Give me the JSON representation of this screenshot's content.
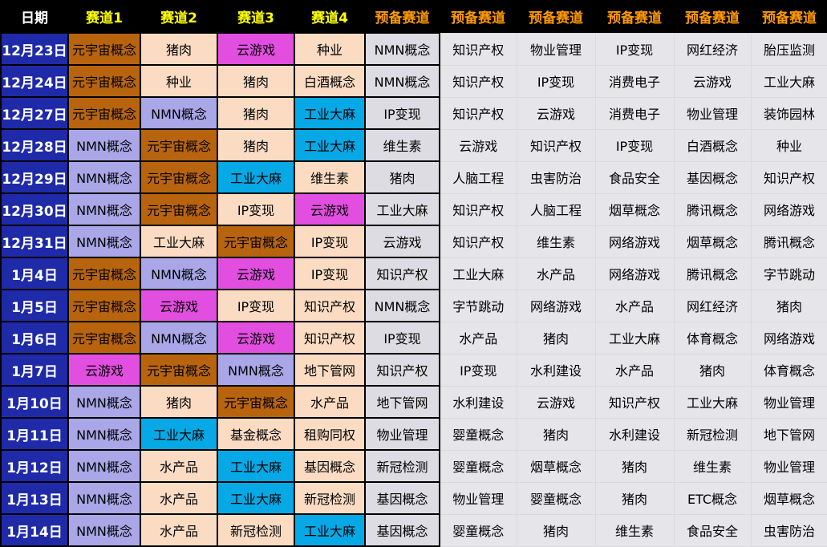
{
  "header": {
    "date": "日期",
    "tracks": [
      "赛道1",
      "赛道2",
      "赛道3",
      "赛道4"
    ],
    "spares": [
      "预备赛道",
      "预备赛道",
      "预备赛道",
      "预备赛道",
      "预备赛道",
      "预备赛道"
    ]
  },
  "colors": {
    "brown": "#b8640f",
    "lavender": "#a9a7e8",
    "peach": "#fbdcc3",
    "magenta": "#e24ee0",
    "cyan": "#06a8e6",
    "date_bg": "#1f2aa8",
    "spare_bg": "#e6e6ea"
  },
  "rows": [
    {
      "date": "12月23日",
      "t1": "元宇宙概念",
      "t1c": "c-brown",
      "t2": "猪肉",
      "t2c": "c-peach",
      "t3": "云游戏",
      "t3c": "c-magenta",
      "t4": "种业",
      "t4c": "c-peach",
      "s": [
        "NMN概念",
        "知识产权",
        "物业管理",
        "IP变现",
        "网红经济",
        "胎压监测"
      ]
    },
    {
      "date": "12月24日",
      "t1": "元宇宙概念",
      "t1c": "c-brown",
      "t2": "种业",
      "t2c": "c-peach",
      "t3": "猪肉",
      "t3c": "c-peach",
      "t4": "白酒概念",
      "t4c": "c-peach",
      "s": [
        "NMN概念",
        "知识产权",
        "IP变现",
        "消费电子",
        "云游戏",
        "工业大麻"
      ]
    },
    {
      "date": "12月27日",
      "t1": "元宇宙概念",
      "t1c": "c-brown",
      "t2": "NMN概念",
      "t2c": "c-lav",
      "t3": "猪肉",
      "t3c": "c-peach",
      "t4": "工业大麻",
      "t4c": "c-cyan",
      "s": [
        "IP变现",
        "知识产权",
        "云游戏",
        "消费电子",
        "物业管理",
        "装饰园林"
      ]
    },
    {
      "date": "12月28日",
      "t1": "NMN概念",
      "t1c": "c-lav",
      "t2": "元宇宙概念",
      "t2c": "c-brown",
      "t3": "猪肉",
      "t3c": "c-peach",
      "t4": "工业大麻",
      "t4c": "c-cyan",
      "s": [
        "维生素",
        "云游戏",
        "知识产权",
        "IP变现",
        "白酒概念",
        "种业"
      ]
    },
    {
      "date": "12月29日",
      "t1": "NMN概念",
      "t1c": "c-lav",
      "t2": "元宇宙概念",
      "t2c": "c-brown",
      "t3": "工业大麻",
      "t3c": "c-cyan",
      "t4": "维生素",
      "t4c": "c-peach",
      "s": [
        "猪肉",
        "人脑工程",
        "虫害防治",
        "食品安全",
        "基因概念",
        "知识产权"
      ]
    },
    {
      "date": "12月30日",
      "t1": "NMN概念",
      "t1c": "c-lav",
      "t2": "元宇宙概念",
      "t2c": "c-brown",
      "t3": "IP变现",
      "t3c": "c-peach",
      "t4": "云游戏",
      "t4c": "c-magenta",
      "s": [
        "工业大麻",
        "知识产权",
        "人脑工程",
        "烟草概念",
        "腾讯概念",
        "网络游戏"
      ]
    },
    {
      "date": "12月31日",
      "t1": "NMN概念",
      "t1c": "c-lav",
      "t2": "工业大麻",
      "t2c": "c-peach",
      "t3": "元宇宙概念",
      "t3c": "c-brown",
      "t4": "IP变现",
      "t4c": "c-peach",
      "s": [
        "云游戏",
        "知识产权",
        "维生素",
        "网络游戏",
        "烟草概念",
        "腾讯概念"
      ]
    },
    {
      "date": "1月4日",
      "t1": "元宇宙概念",
      "t1c": "c-brown",
      "t2": "NMN概念",
      "t2c": "c-lav",
      "t3": "云游戏",
      "t3c": "c-magenta",
      "t4": "IP变现",
      "t4c": "c-peach",
      "s": [
        "知识产权",
        "工业大麻",
        "水产品",
        "网络游戏",
        "腾讯概念",
        "字节跳动"
      ]
    },
    {
      "date": "1月5日",
      "t1": "元宇宙概念",
      "t1c": "c-brown",
      "t2": "云游戏",
      "t2c": "c-magenta",
      "t3": "IP变现",
      "t3c": "c-peach",
      "t4": "知识产权",
      "t4c": "c-peach",
      "s": [
        "NMN概念",
        "字节跳动",
        "网络游戏",
        "水产品",
        "网红经济",
        "猪肉"
      ]
    },
    {
      "date": "1月6日",
      "t1": "元宇宙概念",
      "t1c": "c-brown",
      "t2": "NMN概念",
      "t2c": "c-lav",
      "t3": "云游戏",
      "t3c": "c-magenta",
      "t4": "知识产权",
      "t4c": "c-peach",
      "s": [
        "IP变现",
        "水产品",
        "猪肉",
        "工业大麻",
        "体育概念",
        "网络游戏"
      ]
    },
    {
      "date": "1月7日",
      "t1": "云游戏",
      "t1c": "c-magenta",
      "t2": "元宇宙概念",
      "t2c": "c-brown",
      "t3": "NMN概念",
      "t3c": "c-lav",
      "t4": "地下管网",
      "t4c": "c-peach",
      "s": [
        "知识产权",
        "IP变现",
        "水利建设",
        "水产品",
        "猪肉",
        "体育概念"
      ]
    },
    {
      "date": "1月10日",
      "t1": "NMN概念",
      "t1c": "c-lav",
      "t2": "猪肉",
      "t2c": "c-peach",
      "t3": "元宇宙概念",
      "t3c": "c-brown",
      "t4": "水产品",
      "t4c": "c-peach",
      "s": [
        "地下管网",
        "水利建设",
        "云游戏",
        "知识产权",
        "工业大麻",
        "物业管理"
      ]
    },
    {
      "date": "1月11日",
      "t1": "NMN概念",
      "t1c": "c-lav",
      "t2": "工业大麻",
      "t2c": "c-cyan",
      "t3": "基金概念",
      "t3c": "c-peach",
      "t4": "租购同权",
      "t4c": "c-peach",
      "s": [
        "物业管理",
        "婴童概念",
        "猪肉",
        "水利建设",
        "新冠检测",
        "地下管网"
      ]
    },
    {
      "date": "1月12日",
      "t1": "NMN概念",
      "t1c": "c-lav",
      "t2": "水产品",
      "t2c": "c-peach",
      "t3": "工业大麻",
      "t3c": "c-cyan",
      "t4": "基因概念",
      "t4c": "c-peach",
      "s": [
        "新冠检测",
        "婴童概念",
        "烟草概念",
        "猪肉",
        "维生素",
        "物业管理"
      ]
    },
    {
      "date": "1月13日",
      "t1": "NMN概念",
      "t1c": "c-lav",
      "t2": "水产品",
      "t2c": "c-peach",
      "t3": "工业大麻",
      "t3c": "c-cyan",
      "t4": "新冠检测",
      "t4c": "c-peach",
      "s": [
        "基因概念",
        "物业管理",
        "婴童概念",
        "猪肉",
        "ETC概念",
        "烟草概念"
      ]
    },
    {
      "date": "1月14日",
      "t1": "NMN概念",
      "t1c": "c-lav",
      "t2": "水产品",
      "t2c": "c-peach",
      "t3": "新冠检测",
      "t3c": "c-peach",
      "t4": "工业大麻",
      "t4c": "c-cyan",
      "s": [
        "基因概念",
        "婴童概念",
        "猪肉",
        "维生素",
        "食品安全",
        "虫害防治"
      ]
    }
  ]
}
